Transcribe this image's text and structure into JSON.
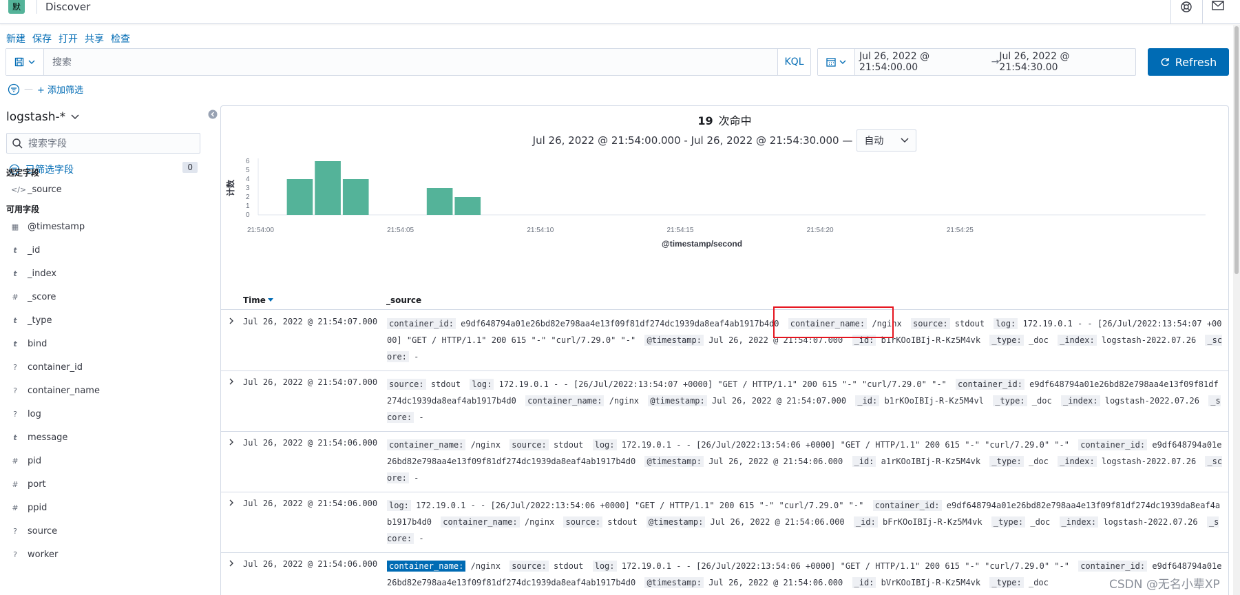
{
  "header": {
    "app_badge": "默",
    "breadcrumb": "Discover"
  },
  "topnav": [
    "新建",
    "保存",
    "打开",
    "共享",
    "检查"
  ],
  "querybar": {
    "placeholder": "搜索",
    "language": "KQL"
  },
  "timepicker": {
    "start": "Jul 26, 2022 @ 21:54:00.00",
    "end": "Jul 26, 2022 @ 21:54:30.00"
  },
  "refresh_label": "Refresh",
  "filter": {
    "add_label": "+ 添加筛选",
    "dash": "—"
  },
  "sidebar": {
    "index_pattern": "logstash-*",
    "field_search_placeholder": "搜索字段",
    "filtered_fields_label": "已筛选字段",
    "filtered_fields_count": "0",
    "selected_title": "选定字段",
    "selected_fields": [
      {
        "type": "</>",
        "name": "_source"
      }
    ],
    "available_title": "可用字段",
    "available_fields": [
      {
        "type": "▦",
        "name": "@timestamp"
      },
      {
        "type": "t",
        "name": "_id"
      },
      {
        "type": "t",
        "name": "_index"
      },
      {
        "type": "#",
        "name": "_score"
      },
      {
        "type": "t",
        "name": "_type"
      },
      {
        "type": "t",
        "name": "bind"
      },
      {
        "type": "?",
        "name": "container_id"
      },
      {
        "type": "?",
        "name": "container_name"
      },
      {
        "type": "?",
        "name": "log"
      },
      {
        "type": "t",
        "name": "message"
      },
      {
        "type": "#",
        "name": "pid"
      },
      {
        "type": "#",
        "name": "port"
      },
      {
        "type": "#",
        "name": "ppid"
      },
      {
        "type": "?",
        "name": "source"
      },
      {
        "type": "?",
        "name": "worker"
      }
    ]
  },
  "hits": {
    "count": "19",
    "label": "次命中",
    "range_text": "Jul 26, 2022 @ 21:54:00.000 - Jul 26, 2022 @ 21:54:30.000 —",
    "interval": "自动"
  },
  "chart_data": {
    "type": "bar",
    "x": [
      "21:54:01",
      "21:54:02",
      "21:54:03",
      "21:54:04",
      "21:54:05",
      "21:54:06",
      "21:54:07",
      "21:54:08"
    ],
    "values": [
      4,
      6,
      4,
      0,
      0,
      3,
      2,
      0
    ],
    "xticks": [
      "21:54:00",
      "21:54:05",
      "21:54:10",
      "21:54:15",
      "21:54:20",
      "21:54:25"
    ],
    "yticks": [
      "0",
      "1",
      "2",
      "3",
      "4",
      "5",
      "6"
    ],
    "xlabel": "@timestamp/second",
    "ylabel": "计数",
    "ylim": [
      0,
      6
    ],
    "xlim_seconds": [
      0,
      30
    ],
    "color": "#54b399"
  },
  "table": {
    "time_header": "Time",
    "source_header": "_source",
    "rows": [
      {
        "time": "Jul 26, 2022 @ 21:54:07.000",
        "fields": [
          {
            "k": "container_id:",
            "v": "e9df648794a01e26bd82e798aa4e13f09f81df274dc1939da8eaf4ab1917b4d0"
          },
          {
            "k": "container_name:",
            "v": "/nginx"
          },
          {
            "k": "source:",
            "v": "stdout"
          },
          {
            "k": "log:",
            "v": "172.19.0.1 - - [26/Jul/2022:13:54:07 +0000] \"GET / HTTP/1.1\" 200 615 \"-\" \"curl/7.29.0\" \"-\""
          },
          {
            "k": "@timestamp:",
            "v": "Jul 26, 2022 @ 21:54:07.000"
          },
          {
            "k": "_id:",
            "v": "b1rKOoIBIj-R-Kz5M4vk"
          },
          {
            "k": "_type:",
            "v": "_doc"
          },
          {
            "k": "_index:",
            "v": "logstash-2022.07.26"
          },
          {
            "k": "_score:",
            "v": "-"
          }
        ]
      },
      {
        "time": "Jul 26, 2022 @ 21:54:07.000",
        "fields": [
          {
            "k": "source:",
            "v": "stdout"
          },
          {
            "k": "log:",
            "v": "172.19.0.1 - - [26/Jul/2022:13:54:07 +0000] \"GET / HTTP/1.1\" 200 615 \"-\" \"curl/7.29.0\" \"-\""
          },
          {
            "k": "container_id:",
            "v": "e9df648794a01e26bd82e798aa4e13f09f81df274dc1939da8eaf4ab1917b4d0"
          },
          {
            "k": "container_name:",
            "v": "/nginx"
          },
          {
            "k": "@timestamp:",
            "v": "Jul 26, 2022 @ 21:54:07.000"
          },
          {
            "k": "_id:",
            "v": "b1rKOoIBIj-R-Kz5M4vl"
          },
          {
            "k": "_type:",
            "v": "_doc"
          },
          {
            "k": "_index:",
            "v": "logstash-2022.07.26"
          },
          {
            "k": "_score:",
            "v": "-"
          }
        ]
      },
      {
        "time": "Jul 26, 2022 @ 21:54:06.000",
        "fields": [
          {
            "k": "container_name:",
            "v": "/nginx"
          },
          {
            "k": "source:",
            "v": "stdout"
          },
          {
            "k": "log:",
            "v": "172.19.0.1 - - [26/Jul/2022:13:54:06 +0000] \"GET / HTTP/1.1\" 200 615 \"-\" \"curl/7.29.0\" \"-\""
          },
          {
            "k": "container_id:",
            "v": "e9df648794a01e26bd82e798aa4e13f09f81df274dc1939da8eaf4ab1917b4d0"
          },
          {
            "k": "@timestamp:",
            "v": "Jul 26, 2022 @ 21:54:06.000"
          },
          {
            "k": "_id:",
            "v": "a1rKOoIBIj-R-Kz5M4vk"
          },
          {
            "k": "_type:",
            "v": "_doc"
          },
          {
            "k": "_index:",
            "v": "logstash-2022.07.26"
          },
          {
            "k": "_score:",
            "v": "-"
          }
        ]
      },
      {
        "time": "Jul 26, 2022 @ 21:54:06.000",
        "fields": [
          {
            "k": "log:",
            "v": "172.19.0.1 - - [26/Jul/2022:13:54:06 +0000] \"GET / HTTP/1.1\" 200 615 \"-\" \"curl/7.29.0\" \"-\""
          },
          {
            "k": "container_id:",
            "v": "e9df648794a01e26bd82e798aa4e13f09f81df274dc1939da8eaf4ab1917b4d0"
          },
          {
            "k": "container_name:",
            "v": "/nginx"
          },
          {
            "k": "source:",
            "v": "stdout"
          },
          {
            "k": "@timestamp:",
            "v": "Jul 26, 2022 @ 21:54:06.000"
          },
          {
            "k": "_id:",
            "v": "bFrKOoIBIj-R-Kz5M4vk"
          },
          {
            "k": "_type:",
            "v": "_doc"
          },
          {
            "k": "_index:",
            "v": "logstash-2022.07.26"
          },
          {
            "k": "_score:",
            "v": "-"
          }
        ]
      },
      {
        "time": "Jul 26, 2022 @ 21:54:06.000",
        "highlight_first": true,
        "fields": [
          {
            "k": "container_name:",
            "v": "/nginx"
          },
          {
            "k": "source:",
            "v": "stdout"
          },
          {
            "k": "log:",
            "v": "172.19.0.1 - - [26/Jul/2022:13:54:06 +0000] \"GET / HTTP/1.1\" 200 615 \"-\" \"curl/7.29.0\" \"-\""
          },
          {
            "k": "container_id:",
            "v": "e9df648794a01e26bd82e798aa4e13f09f81df274dc1939da8eaf4ab1917b4d0"
          },
          {
            "k": "@timestamp:",
            "v": "Jul 26, 2022 @ 21:54:06.000"
          },
          {
            "k": "_id:",
            "v": "bVrKOoIBIj-R-Kz5M4vk"
          },
          {
            "k": "_type:",
            "v": "_doc"
          }
        ]
      }
    ]
  },
  "watermark": "CSDN @无名小辈XP",
  "colors": {
    "accent": "#006bb4",
    "bar": "#54b399",
    "annotation": "#e5141e"
  }
}
